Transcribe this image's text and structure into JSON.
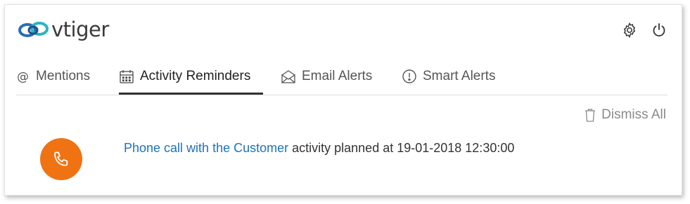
{
  "header": {
    "brand_name": "vtiger",
    "settings_icon": "gear-icon",
    "power_icon": "power-icon"
  },
  "tabs": [
    {
      "label": "Mentions",
      "icon": "at-icon",
      "active": false
    },
    {
      "label": "Activity Reminders",
      "icon": "calendar-icon",
      "active": true
    },
    {
      "label": "Email Alerts",
      "icon": "envelope-icon",
      "active": false
    },
    {
      "label": "Smart Alerts",
      "icon": "alert-icon",
      "active": false
    }
  ],
  "actions": {
    "dismiss_all_label": "Dismiss All",
    "dismiss_icon": "trash-icon"
  },
  "notification": {
    "link_text": "Phone call with the Customer",
    "message": " activity planned at 19-01-2018 12:30:00",
    "icon": "phone-icon",
    "icon_color": "#f07313",
    "link_color": "#1a73c0"
  }
}
